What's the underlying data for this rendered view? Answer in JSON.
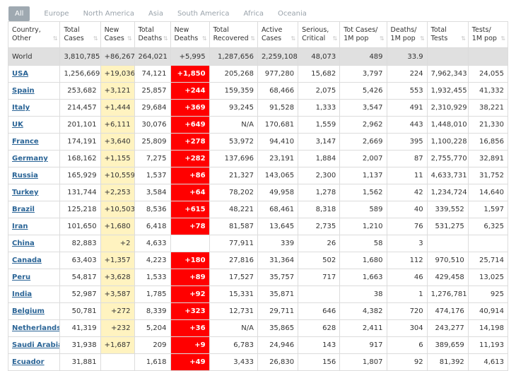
{
  "tabs": [
    "All",
    "Europe",
    "North America",
    "Asia",
    "South America",
    "Africa",
    "Oceania"
  ],
  "headers": [
    {
      "l1": "Country,",
      "l2": "Other"
    },
    {
      "l1": "Total",
      "l2": "Cases"
    },
    {
      "l1": "New",
      "l2": "Cases"
    },
    {
      "l1": "Total",
      "l2": "Deaths"
    },
    {
      "l1": "New",
      "l2": "Deaths"
    },
    {
      "l1": "Total",
      "l2": "Recovered"
    },
    {
      "l1": "Active",
      "l2": "Cases"
    },
    {
      "l1": "Serious,",
      "l2": "Critical"
    },
    {
      "l1": "Tot Cases/",
      "l2": "1M pop"
    },
    {
      "l1": "Deaths/",
      "l2": "1M pop"
    },
    {
      "l1": "Total",
      "l2": "Tests"
    },
    {
      "l1": "Tests/",
      "l2": "1M pop"
    }
  ],
  "world": [
    "World",
    "3,810,785",
    "+86,267",
    "264,021",
    "+5,995",
    "1,287,656",
    "2,259,108",
    "48,073",
    "489",
    "33.9",
    "",
    ""
  ],
  "rows": [
    [
      "USA",
      "1,256,669",
      "+19,036",
      "74,121",
      "+1,850",
      "205,268",
      "977,280",
      "15,682",
      "3,797",
      "224",
      "7,962,343",
      "24,055"
    ],
    [
      "Spain",
      "253,682",
      "+3,121",
      "25,857",
      "+244",
      "159,359",
      "68,466",
      "2,075",
      "5,426",
      "553",
      "1,932,455",
      "41,332"
    ],
    [
      "Italy",
      "214,457",
      "+1,444",
      "29,684",
      "+369",
      "93,245",
      "91,528",
      "1,333",
      "3,547",
      "491",
      "2,310,929",
      "38,221"
    ],
    [
      "UK",
      "201,101",
      "+6,111",
      "30,076",
      "+649",
      "N/A",
      "170,681",
      "1,559",
      "2,962",
      "443",
      "1,448,010",
      "21,330"
    ],
    [
      "France",
      "174,191",
      "+3,640",
      "25,809",
      "+278",
      "53,972",
      "94,410",
      "3,147",
      "2,669",
      "395",
      "1,100,228",
      "16,856"
    ],
    [
      "Germany",
      "168,162",
      "+1,155",
      "7,275",
      "+282",
      "137,696",
      "23,191",
      "1,884",
      "2,007",
      "87",
      "2,755,770",
      "32,891"
    ],
    [
      "Russia",
      "165,929",
      "+10,559",
      "1,537",
      "+86",
      "21,327",
      "143,065",
      "2,300",
      "1,137",
      "11",
      "4,633,731",
      "31,752"
    ],
    [
      "Turkey",
      "131,744",
      "+2,253",
      "3,584",
      "+64",
      "78,202",
      "49,958",
      "1,278",
      "1,562",
      "42",
      "1,234,724",
      "14,640"
    ],
    [
      "Brazil",
      "125,218",
      "+10,503",
      "8,536",
      "+615",
      "48,221",
      "68,461",
      "8,318",
      "589",
      "40",
      "339,552",
      "1,597"
    ],
    [
      "Iran",
      "101,650",
      "+1,680",
      "6,418",
      "+78",
      "81,587",
      "13,645",
      "2,735",
      "1,210",
      "76",
      "531,275",
      "6,325"
    ],
    [
      "China",
      "82,883",
      "+2",
      "4,633",
      "",
      "77,911",
      "339",
      "26",
      "58",
      "3",
      "",
      ""
    ],
    [
      "Canada",
      "63,403",
      "+1,357",
      "4,223",
      "+180",
      "27,816",
      "31,364",
      "502",
      "1,680",
      "112",
      "970,510",
      "25,714"
    ],
    [
      "Peru",
      "54,817",
      "+3,628",
      "1,533",
      "+89",
      "17,527",
      "35,757",
      "717",
      "1,663",
      "46",
      "429,458",
      "13,025"
    ],
    [
      "India",
      "52,987",
      "+3,587",
      "1,785",
      "+92",
      "15,331",
      "35,871",
      "",
      "38",
      "1",
      "1,276,781",
      "925"
    ],
    [
      "Belgium",
      "50,781",
      "+272",
      "8,339",
      "+323",
      "12,731",
      "29,711",
      "646",
      "4,382",
      "720",
      "474,176",
      "40,914"
    ],
    [
      "Netherlands",
      "41,319",
      "+232",
      "5,204",
      "+36",
      "N/A",
      "35,865",
      "628",
      "2,411",
      "304",
      "243,277",
      "14,198"
    ],
    [
      "Saudi Arabia",
      "31,938",
      "+1,687",
      "209",
      "+9",
      "6,783",
      "24,946",
      "143",
      "917",
      "6",
      "389,659",
      "11,193"
    ],
    [
      "Ecuador",
      "31,881",
      "",
      "1,618",
      "+49",
      "3,433",
      "26,830",
      "156",
      "1,807",
      "92",
      "81,392",
      "4,613"
    ]
  ]
}
